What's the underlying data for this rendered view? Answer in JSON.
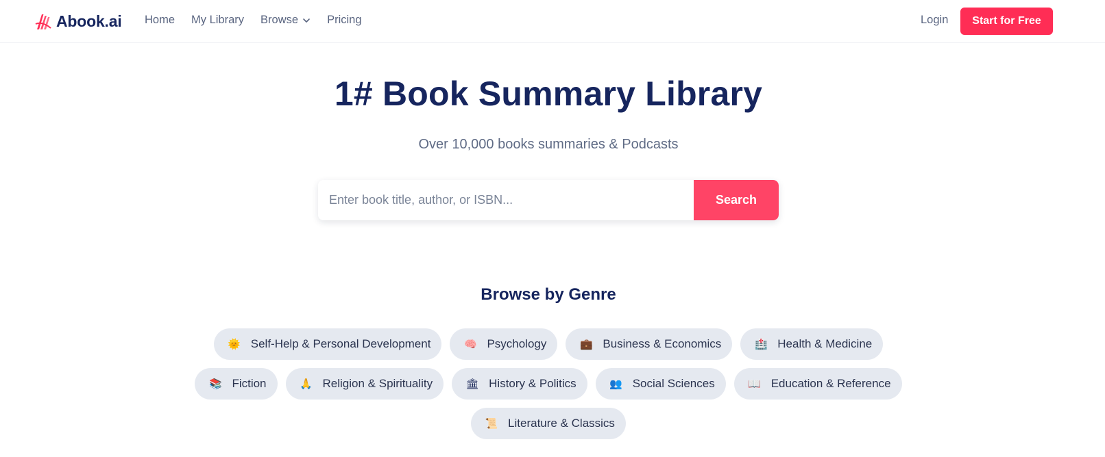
{
  "nav": {
    "brand": "Abook.ai",
    "links": [
      {
        "label": "Home"
      },
      {
        "label": "My Library"
      },
      {
        "label": "Browse",
        "icon": "chevron-down-icon"
      },
      {
        "label": "Pricing"
      }
    ],
    "login": "Login",
    "cta": "Start for Free"
  },
  "hero": {
    "title": "1# Book Summary Library",
    "subtitle": "Over 10,000 books summaries & Podcasts"
  },
  "search": {
    "placeholder": "Enter book title, author, or ISBN...",
    "value": "",
    "button": "Search"
  },
  "genres": {
    "heading": "Browse by Genre",
    "items": [
      {
        "label": "Self-Help & Personal Development",
        "icon": "sun-icon"
      },
      {
        "label": "Psychology",
        "icon": "brain-icon"
      },
      {
        "label": "Business & Economics",
        "icon": "briefcase-icon"
      },
      {
        "label": "Health & Medicine",
        "icon": "medical-icon"
      },
      {
        "label": "Fiction",
        "icon": "books-icon"
      },
      {
        "label": "Religion & Spirituality",
        "icon": "prayer-icon"
      },
      {
        "label": "History & Politics",
        "icon": "classical-building-icon"
      },
      {
        "label": "Social Sciences",
        "icon": "people-icon"
      },
      {
        "label": "Education & Reference",
        "icon": "open-book-icon"
      },
      {
        "label": "Literature & Classics",
        "icon": "scroll-icon"
      }
    ]
  },
  "colors": {
    "brand": "#ff2d55",
    "search_button": "#ff4466",
    "heading": "#16255e",
    "pill_bg": "#e5e9f0"
  }
}
